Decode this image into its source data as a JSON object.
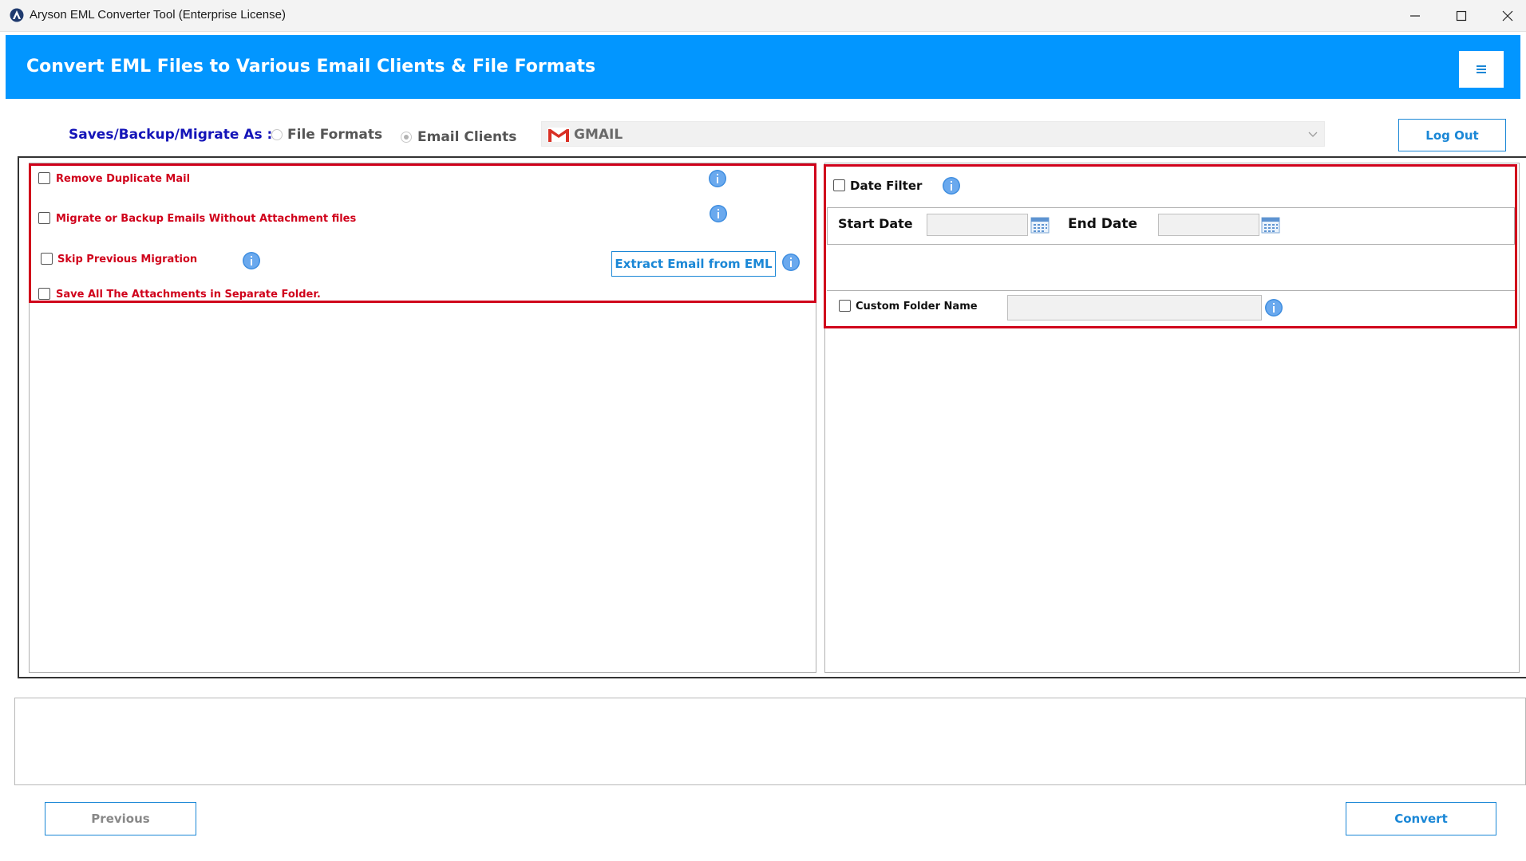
{
  "window": {
    "title": "Aryson EML Converter Tool (Enterprise License)"
  },
  "header": {
    "title": "Convert EML Files to Various Email Clients & File Formats"
  },
  "saves": {
    "label": "Saves/Backup/Migrate As :",
    "option_file_formats": "File Formats",
    "option_email_clients": "Email Clients",
    "selected_option": "Email Clients",
    "client_value": "GMAIL",
    "logout_label": "Log Out"
  },
  "left_options": {
    "remove_duplicate": "Remove Duplicate Mail",
    "without_attachment": "Migrate or Backup Emails Without Attachment files",
    "skip_previous": "Skip Previous Migration",
    "save_attachments": "Save All The Attachments in Separate Folder.",
    "extract_label": "Extract Email from EML"
  },
  "right_options": {
    "date_filter": "Date Filter",
    "start_date": "Start Date",
    "end_date": "End Date",
    "custom_folder": "Custom Folder Name"
  },
  "footer": {
    "previous_label": "Previous",
    "convert_label": "Convert"
  },
  "colors": {
    "header_blue": "#0296ff",
    "accent_blue": "#1a87d6",
    "highlight_red": "#d0021b",
    "label_navy": "#1414b8"
  },
  "icons": {
    "app": "app-logo-icon",
    "menu": "hamburger-menu-icon",
    "gmail": "gmail-icon",
    "info": "info-icon",
    "calendar": "calendar-icon",
    "dropdown": "chevron-down-icon"
  }
}
